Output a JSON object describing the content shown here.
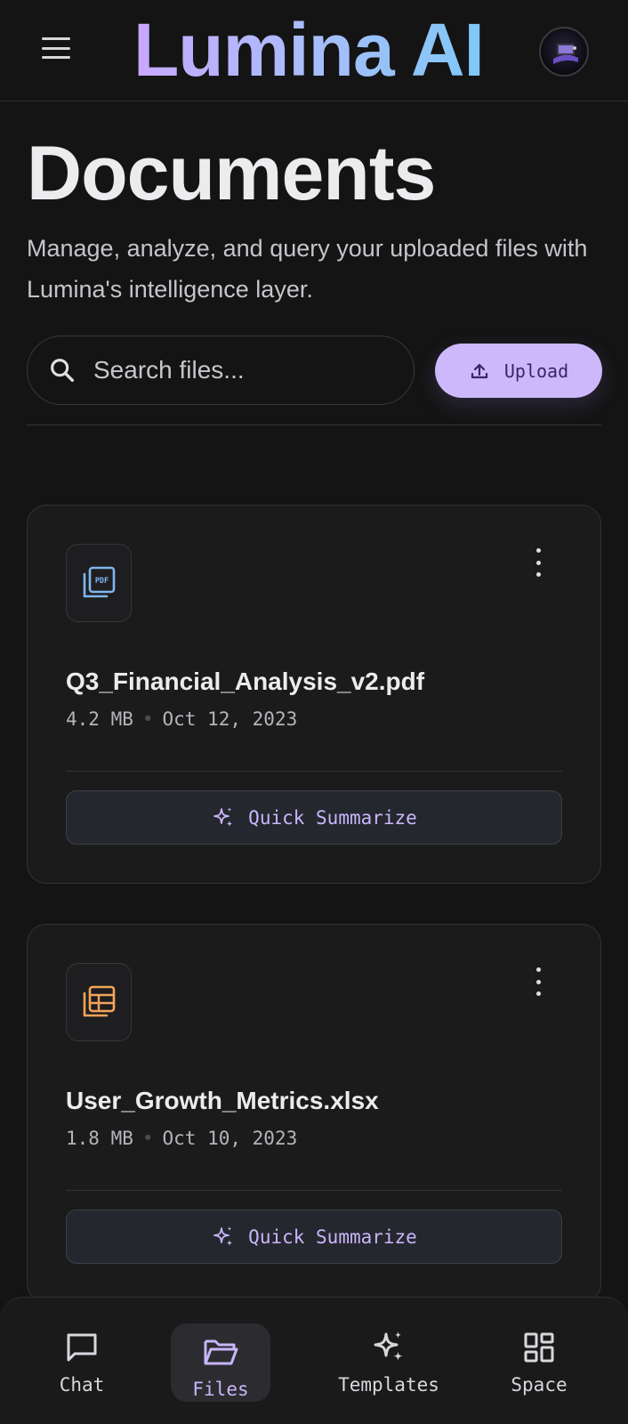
{
  "app": {
    "title": "Lumina AI"
  },
  "header": {
    "title": "Documents",
    "subtitle": "Manage, analyze, and query your uploaded files with Lumina's intelligence layer."
  },
  "search": {
    "placeholder": "Search files...",
    "value": ""
  },
  "upload": {
    "label": "Upload"
  },
  "files": [
    {
      "name": "Q3_Financial_Analysis_v2.pdf",
      "size": "4.2 MB",
      "date": "Oct 12, 2023",
      "icon": "pdf-icon",
      "icon_color": "#7fb6f0",
      "action": "Quick Summarize"
    },
    {
      "name": "User_Growth_Metrics.xlsx",
      "size": "1.8 MB",
      "date": "Oct 10, 2023",
      "icon": "table-icon",
      "icon_color": "#f4a45a",
      "action": "Quick Summarize"
    }
  ],
  "nav": {
    "items": [
      {
        "label": "Chat",
        "icon": "chat-icon",
        "active": false
      },
      {
        "label": "Files",
        "icon": "folder-icon",
        "active": true
      },
      {
        "label": "Templates",
        "icon": "sparkles-icon",
        "active": false
      },
      {
        "label": "Space",
        "icon": "grid-icon",
        "active": false
      }
    ]
  },
  "colors": {
    "accent": "#cdb8fb",
    "background": "#141414",
    "card": "#1b1b1c",
    "active_label": "#c9b6fa"
  }
}
